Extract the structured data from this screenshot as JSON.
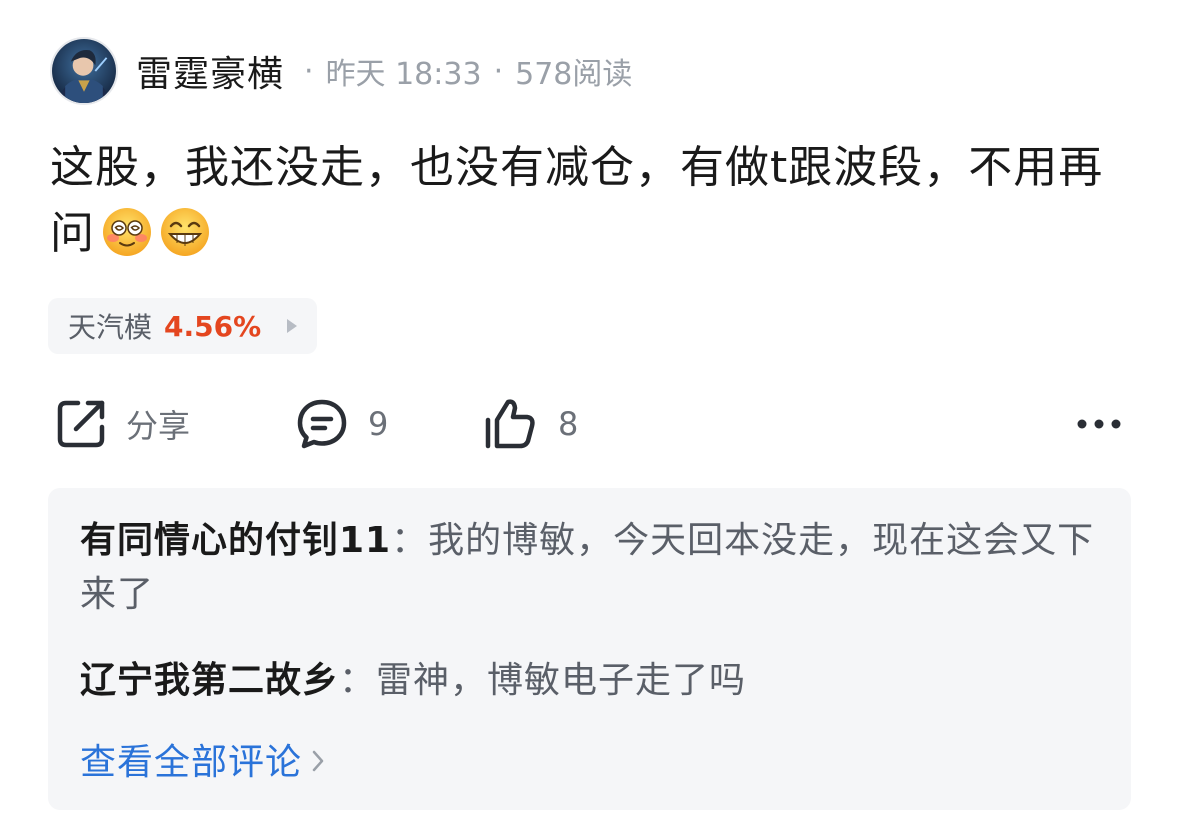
{
  "post": {
    "username": "雷霆豪横",
    "time": "昨天 18:33",
    "reads": "578阅读",
    "separator": "·",
    "text": "这股，我还没走，也没有减仓，有做t跟波段，不用再问",
    "emojis": [
      "dizzy-face-emoji",
      "grinning-face-emoji"
    ]
  },
  "stock": {
    "name": "天汽模",
    "change": "4.56%",
    "change_color": "#e4461f"
  },
  "actions": {
    "share_label": "分享",
    "comment_count": "9",
    "like_count": "8"
  },
  "comments": {
    "items": [
      {
        "author": "有同情心的付钊11",
        "sep": "：",
        "text": "我的博敏，今天回本没走，现在这会又下来了"
      },
      {
        "author": "辽宁我第二故乡",
        "sep": "：",
        "text": "雷神，博敏电子走了吗"
      }
    ],
    "view_all_label": "查看全部评论",
    "link_color": "#2a73d9"
  }
}
